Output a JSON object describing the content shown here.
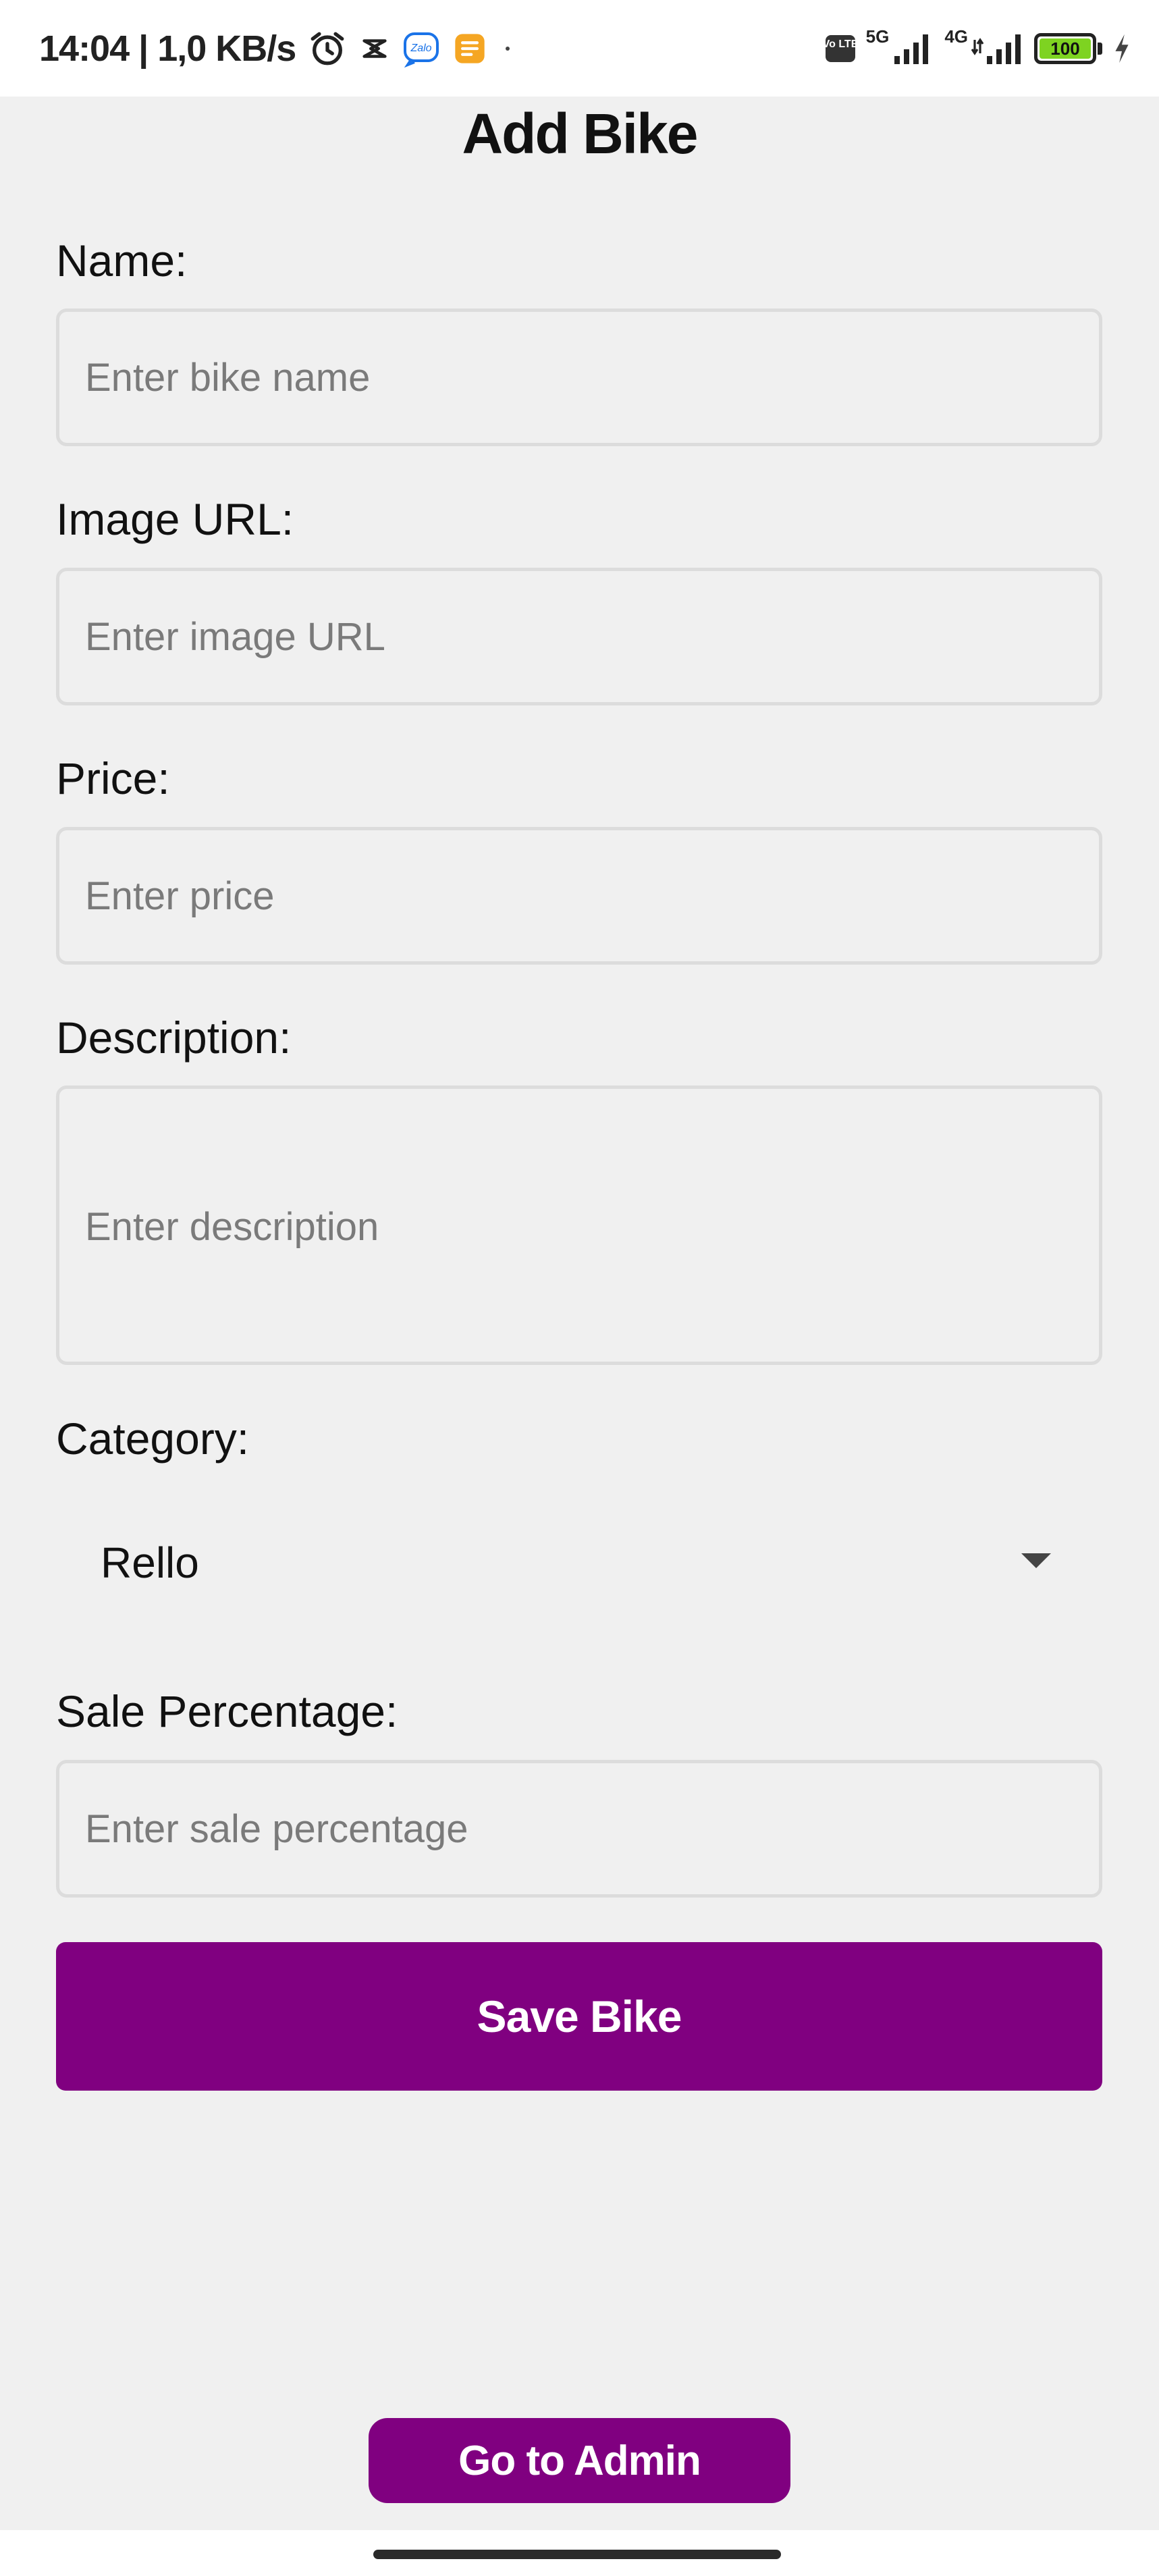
{
  "status_bar": {
    "time": "14:04 | 1,0 KB/s",
    "notification_icons": [
      "alarm-icon",
      "capcut-icon",
      "zalo-icon",
      "notes-icon",
      "dot-icon"
    ],
    "zalo_label": "Zalo",
    "volte_label": "Vo LTE",
    "network_1": "5G",
    "network_2": "4G",
    "battery_level": "100",
    "battery_percent": 100,
    "charging": true
  },
  "page": {
    "title": "Add Bike"
  },
  "form": {
    "name": {
      "label": "Name:",
      "placeholder": "Enter bike name",
      "value": ""
    },
    "image_url": {
      "label": "Image URL:",
      "placeholder": "Enter image URL",
      "value": ""
    },
    "price": {
      "label": "Price:",
      "placeholder": "Enter price",
      "value": ""
    },
    "description": {
      "label": "Description:",
      "placeholder": "Enter description",
      "value": ""
    },
    "category": {
      "label": "Category:",
      "selected": "Rello"
    },
    "sale_percentage": {
      "label": "Sale Percentage:",
      "placeholder": "Enter sale percentage",
      "value": ""
    },
    "save_label": "Save Bike"
  },
  "footer": {
    "admin_label": "Go to Admin"
  },
  "colors": {
    "accent": "#800080",
    "background": "#f0f0f0",
    "input_border": "#dcdcdc",
    "placeholder": "#7a7a7a",
    "battery_fill": "#7ed321"
  }
}
